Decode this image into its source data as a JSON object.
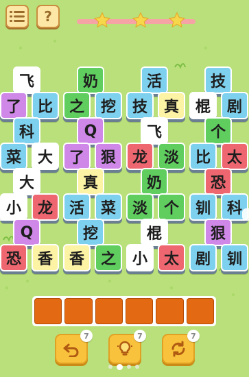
{
  "colors": {
    "background": "#b9e07a",
    "blue": "#7ed1ee",
    "green": "#5fce5f",
    "pink": "#ee6770",
    "white": "#ffffff",
    "yellow": "#fdf3a5",
    "purple": "#cf88e8",
    "slot": "#e36a12",
    "tool": "#f9c23c"
  },
  "header": {
    "menu_icon": "list-icon",
    "help_label": "?",
    "stars": [
      "star",
      "star",
      "star"
    ],
    "progress_icon": "progress-track"
  },
  "board": {
    "tiles": [
      {
        "char": "飞",
        "color": "white"
      },
      {
        "char": "奶",
        "color": "green"
      },
      {
        "char": "活",
        "color": "blue"
      },
      {
        "char": "技",
        "color": "blue"
      },
      {
        "char": "了",
        "color": "purple"
      },
      {
        "char": "比",
        "color": "blue"
      },
      {
        "char": "之",
        "color": "green"
      },
      {
        "char": "挖",
        "color": "blue"
      },
      {
        "char": "技",
        "color": "blue"
      },
      {
        "char": "真",
        "color": "yellow"
      },
      {
        "char": "棍",
        "color": "white"
      },
      {
        "char": "剧",
        "color": "blue"
      },
      {
        "char": "科",
        "color": "blue"
      },
      {
        "char": "Q",
        "color": "purple"
      },
      {
        "char": "飞",
        "color": "white"
      },
      {
        "char": "个",
        "color": "green"
      },
      {
        "char": "菜",
        "color": "blue"
      },
      {
        "char": "大",
        "color": "white"
      },
      {
        "char": "了",
        "color": "purple"
      },
      {
        "char": "狠",
        "color": "purple"
      },
      {
        "char": "龙",
        "color": "pink"
      },
      {
        "char": "淡",
        "color": "green"
      },
      {
        "char": "比",
        "color": "blue"
      },
      {
        "char": "太",
        "color": "pink"
      },
      {
        "char": "大",
        "color": "white"
      },
      {
        "char": "真",
        "color": "yellow"
      },
      {
        "char": "奶",
        "color": "green"
      },
      {
        "char": "恐",
        "color": "pink"
      },
      {
        "char": "小",
        "color": "white"
      },
      {
        "char": "龙",
        "color": "pink"
      },
      {
        "char": "活",
        "color": "blue"
      },
      {
        "char": "菜",
        "color": "blue"
      },
      {
        "char": "淡",
        "color": "green"
      },
      {
        "char": "个",
        "color": "green"
      },
      {
        "char": "钏",
        "color": "blue"
      },
      {
        "char": "科",
        "color": "blue"
      },
      {
        "char": "Q",
        "color": "purple"
      },
      {
        "char": "挖",
        "color": "blue"
      },
      {
        "char": "棍",
        "color": "white"
      },
      {
        "char": "狠",
        "color": "purple"
      },
      {
        "char": "恐",
        "color": "pink"
      },
      {
        "char": "香",
        "color": "yellow"
      },
      {
        "char": "香",
        "color": "yellow"
      },
      {
        "char": "之",
        "color": "green"
      },
      {
        "char": "小",
        "color": "white"
      },
      {
        "char": "太",
        "color": "pink"
      },
      {
        "char": "剧",
        "color": "blue"
      },
      {
        "char": "钏",
        "color": "blue"
      }
    ]
  },
  "tray": {
    "slot_count": 7,
    "filled": 0
  },
  "tools": [
    {
      "name": "undo-icon",
      "count": "7"
    },
    {
      "name": "hint-lightbulb-icon",
      "count": "7"
    },
    {
      "name": "shuffle-icon",
      "count": "7"
    }
  ],
  "pager": {
    "pages": 4,
    "active": 2
  }
}
